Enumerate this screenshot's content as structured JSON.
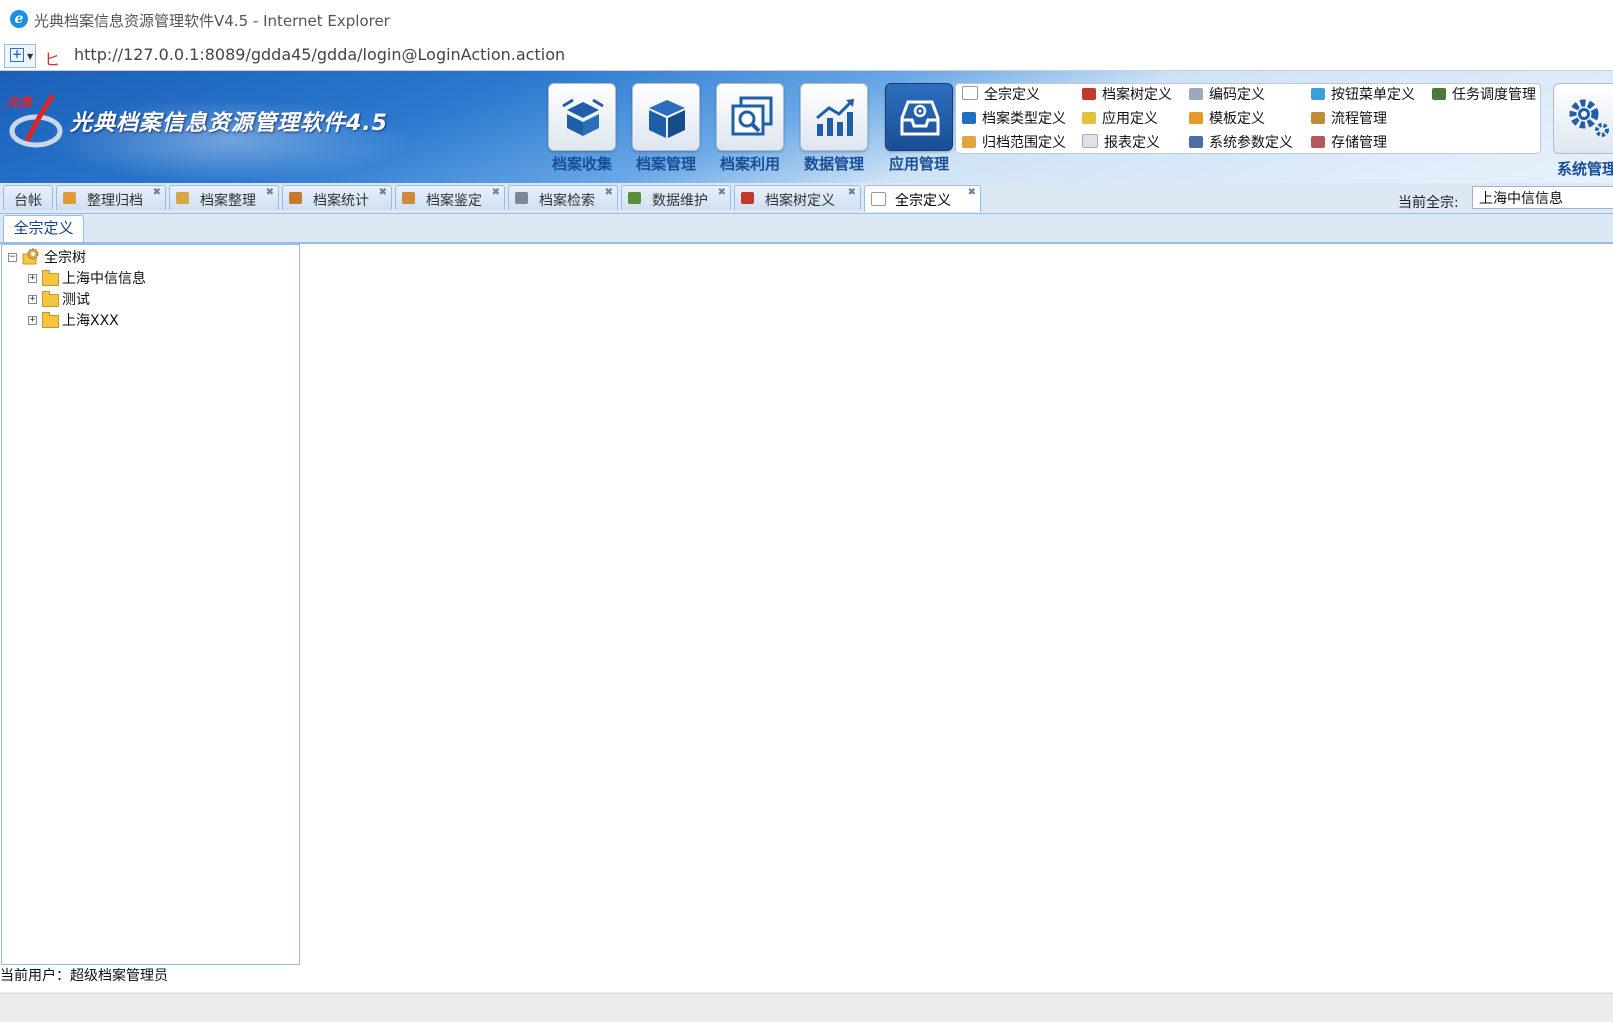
{
  "window": {
    "title": "光典档案信息资源管理软件V4.5 - Internet Explorer"
  },
  "address": {
    "url": "http://127.0.0.1:8089/gdda45/gdda/login@LoginAction.action"
  },
  "header": {
    "brand": "光典档案信息资源管理软件4.5",
    "logo_text": "光典",
    "modules": [
      {
        "label": "档案收集",
        "icon": "box-open-icon"
      },
      {
        "label": "档案管理",
        "icon": "cube-icon"
      },
      {
        "label": "档案利用",
        "icon": "search-documents-icon"
      },
      {
        "label": "数据管理",
        "icon": "chart-up-icon"
      },
      {
        "label": "应用管理",
        "icon": "app-tray-gear-icon",
        "active": true
      }
    ],
    "app_menu": [
      {
        "label": "全宗定义",
        "icon": "page-icon",
        "color": "#ffffff"
      },
      {
        "label": "档案树定义",
        "icon": "tree-def-icon",
        "color": "#c0392b"
      },
      {
        "label": "编码定义",
        "icon": "code-def-icon",
        "color": "#9aa9bd"
      },
      {
        "label": "按钮菜单定义",
        "icon": "button-menu-icon",
        "color": "#3aa0d8"
      },
      {
        "label": "任务调度管理",
        "icon": "task-schedule-icon",
        "color": "#4c7a3a"
      },
      {
        "label": "档案类型定义",
        "icon": "archive-type-icon",
        "color": "#1f6fc0"
      },
      {
        "label": "应用定义",
        "icon": "app-def-icon",
        "color": "#e2c23a"
      },
      {
        "label": "模板定义",
        "icon": "template-icon",
        "color": "#e59a2a"
      },
      {
        "label": "流程管理",
        "icon": "workflow-icon",
        "color": "#c08b3a"
      },
      {
        "label": "归档范围定义",
        "icon": "archive-scope-icon",
        "color": "#e0a640"
      },
      {
        "label": "报表定义",
        "icon": "report-icon",
        "color": "#dfe3e8"
      },
      {
        "label": "系统参数定义",
        "icon": "system-param-icon",
        "color": "#4a6fa8"
      },
      {
        "label": "存储管理",
        "icon": "storage-icon",
        "color": "#b45a5a"
      }
    ],
    "system_label": "系统管理"
  },
  "tabs": [
    {
      "label": "台帐",
      "icon": null,
      "closable": false
    },
    {
      "label": "整理归档",
      "icon": "handshake-icon",
      "color": "#e09a3a",
      "closable": true
    },
    {
      "label": "档案整理",
      "icon": "files-icon",
      "color": "#d9a640",
      "closable": true
    },
    {
      "label": "档案统计",
      "icon": "stats-icon",
      "color": "#c47a2a",
      "closable": true
    },
    {
      "label": "档案鉴定",
      "icon": "magnifier-icon",
      "color": "#d0883a",
      "closable": true
    },
    {
      "label": "档案检索",
      "icon": "tools-icon",
      "color": "#7a8898",
      "closable": true
    },
    {
      "label": "数据维护",
      "icon": "database-icon",
      "color": "#5a8f3a",
      "closable": true
    },
    {
      "label": "档案树定义",
      "icon": "tree-def-icon",
      "color": "#c0392b",
      "closable": true
    },
    {
      "label": "全宗定义",
      "icon": "page-icon",
      "color": "#ffffff",
      "closable": true,
      "active": true
    }
  ],
  "current_zong": {
    "label": "当前全宗:",
    "value": "上海中信信息"
  },
  "subtab": {
    "label": "全宗定义"
  },
  "tree": {
    "root": {
      "label": "全宗树",
      "icon": "gear-folder-icon",
      "expanded": true
    },
    "children": [
      {
        "label": "上海中信信息",
        "icon": "folder-icon",
        "expanded": false
      },
      {
        "label": "测试",
        "icon": "folder-icon",
        "expanded": false
      },
      {
        "label": "上海XXX",
        "icon": "folder-icon",
        "expanded": false
      }
    ]
  },
  "footer": {
    "current_user": "当前用户：超级档案管理员"
  },
  "colors": {
    "accent": "#1b4f95",
    "tab_border": "#99bbe8",
    "tab_bg": "#dde8f5",
    "module_active": "#1a4f96"
  }
}
